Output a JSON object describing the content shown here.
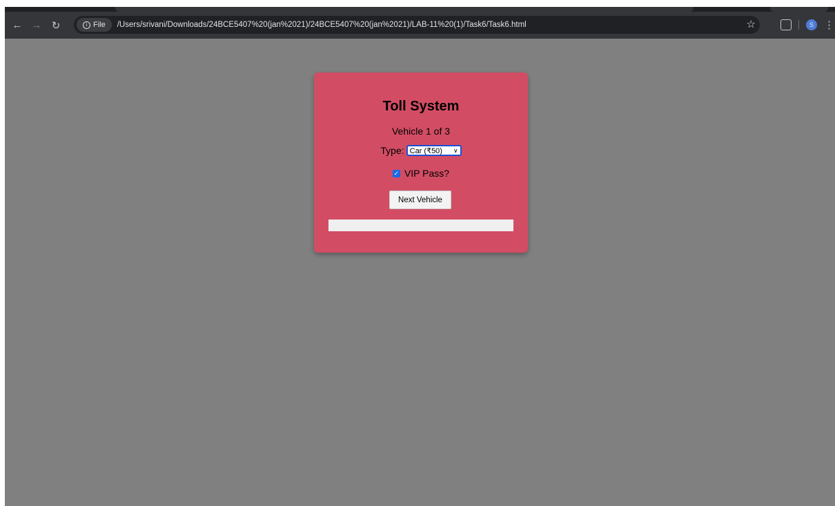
{
  "browser": {
    "chip_label": "File",
    "url": "/Users/srivani/Downloads/24BCE5407%20(jan%2021)/24BCE5407%20(jan%2021)/LAB-11%20(1)/Task6/Task6.html",
    "profile_initial": "S",
    "icons": [
      "back-arrow-icon",
      "forward-arrow-icon",
      "reload-icon",
      "info-icon",
      "star-icon",
      "extensions-icon",
      "profile-avatar-icon",
      "kebab-menu-icon"
    ]
  },
  "app": {
    "title": "Toll System",
    "counter": "Vehicle 1 of 3",
    "type_label": "Type:",
    "type_selected": "Car (₹50)",
    "vip_label": "VIP Pass?",
    "vip_checked": true,
    "next_button": "Next Vehicle",
    "output_text": ""
  },
  "colors": {
    "card": "#d24d64",
    "page_bg": "#808080",
    "select_border": "#1a4fd6",
    "checkbox": "#1a6ae6"
  }
}
